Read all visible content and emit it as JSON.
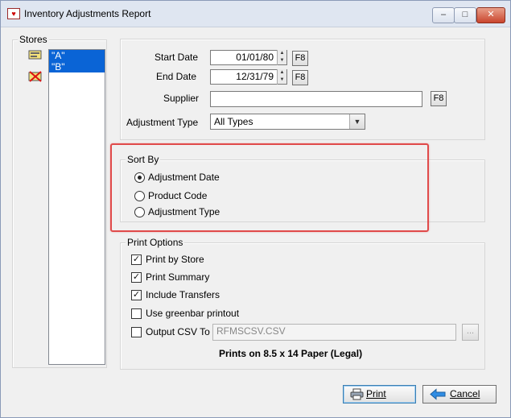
{
  "window": {
    "title": "Inventory Adjustments Report",
    "minimize": "–",
    "maximize": "□",
    "close": "✕"
  },
  "stores": {
    "label": "Stores",
    "items": [
      "\"A\"",
      "\"B\""
    ]
  },
  "form": {
    "start_date_label": "Start Date",
    "start_date_value": "01/01/80",
    "end_date_label": "End Date",
    "end_date_value": "12/31/79",
    "supplier_label": "Supplier",
    "supplier_value": "",
    "adjustment_type_label": "Adjustment Type",
    "adjustment_type_value": "All Types",
    "f8_label": "F8"
  },
  "sort_by": {
    "label": "Sort By",
    "options": [
      "Adjustment Date",
      "Product Code",
      "Adjustment Type"
    ],
    "selected": "Adjustment Date"
  },
  "print_options": {
    "label": "Print Options",
    "print_by_store": "Print by Store",
    "print_summary": "Print Summary",
    "include_transfers": "Include Transfers",
    "greenbar": "Use greenbar printout",
    "output_csv": "Output CSV To",
    "csv_value": "RFMSCSV.CSV",
    "browse": "...",
    "paper_note": "Prints on 8.5 x 14 Paper (Legal)"
  },
  "buttons": {
    "print": "Print",
    "cancel": "Cancel"
  },
  "colors": {
    "highlight": "#e04a4a",
    "selection": "#0a64d6"
  }
}
